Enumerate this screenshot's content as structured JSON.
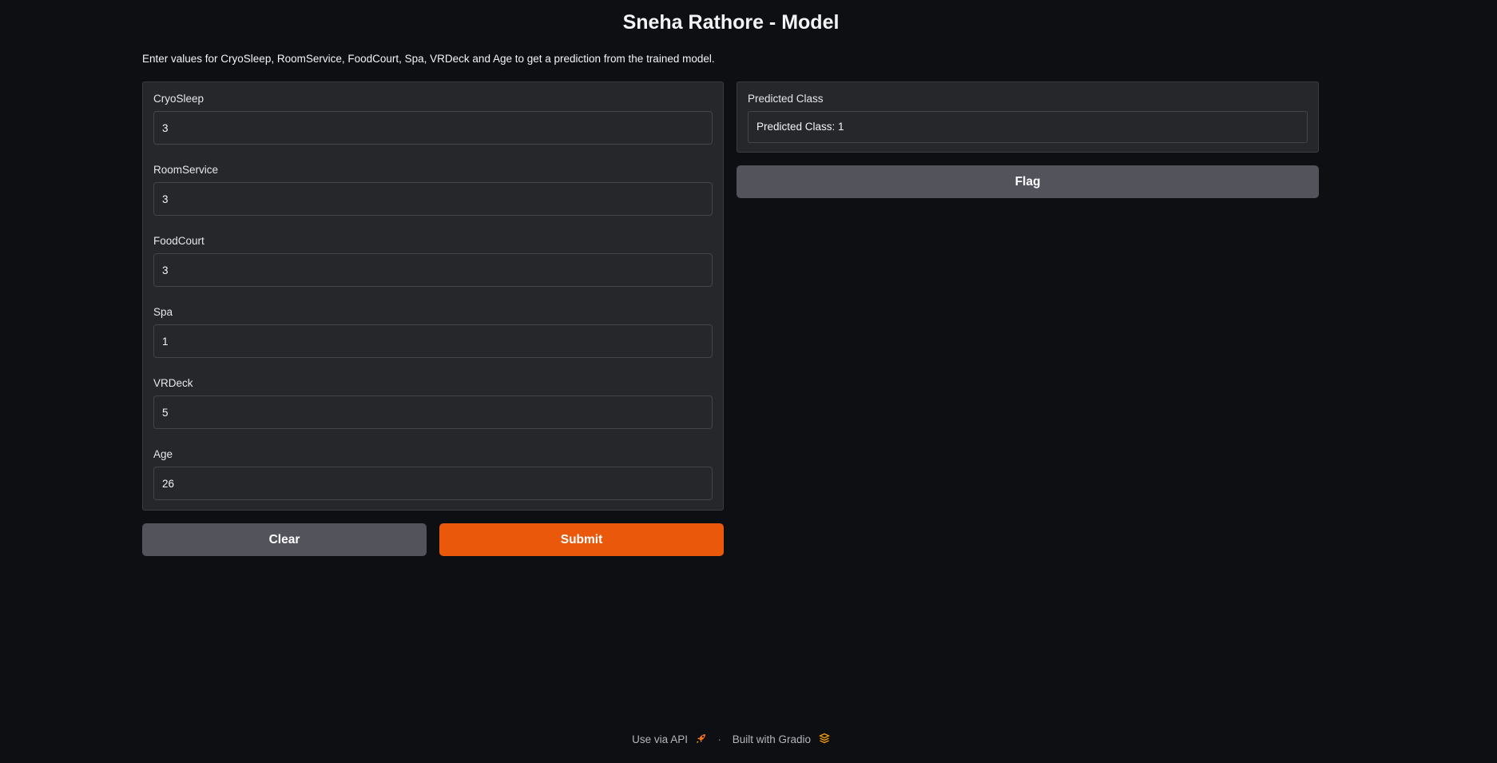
{
  "title": "Sneha Rathore - Model",
  "description": "Enter values for CryoSleep, RoomService, FoodCourt, Spa, VRDeck and Age to get a prediction from the trained model.",
  "inputs": [
    {
      "label": "CryoSleep",
      "value": "3"
    },
    {
      "label": "RoomService",
      "value": "3"
    },
    {
      "label": "FoodCourt",
      "value": "3"
    },
    {
      "label": "Spa",
      "value": "1"
    },
    {
      "label": "VRDeck",
      "value": "5"
    },
    {
      "label": "Age",
      "value": "26"
    }
  ],
  "buttons": {
    "clear": "Clear",
    "submit": "Submit",
    "flag": "Flag"
  },
  "output": {
    "label": "Predicted Class",
    "value": "Predicted Class: 1"
  },
  "footer": {
    "api_link": "Use via API",
    "separator": "·",
    "built_with": "Built with Gradio",
    "api_icon": "rocket-icon",
    "gradio_icon": "gradio-logo-icon"
  },
  "colors": {
    "background": "#0e0f12",
    "panel": "#26272b",
    "primary": "#ea580c",
    "secondary": "#52535b"
  }
}
